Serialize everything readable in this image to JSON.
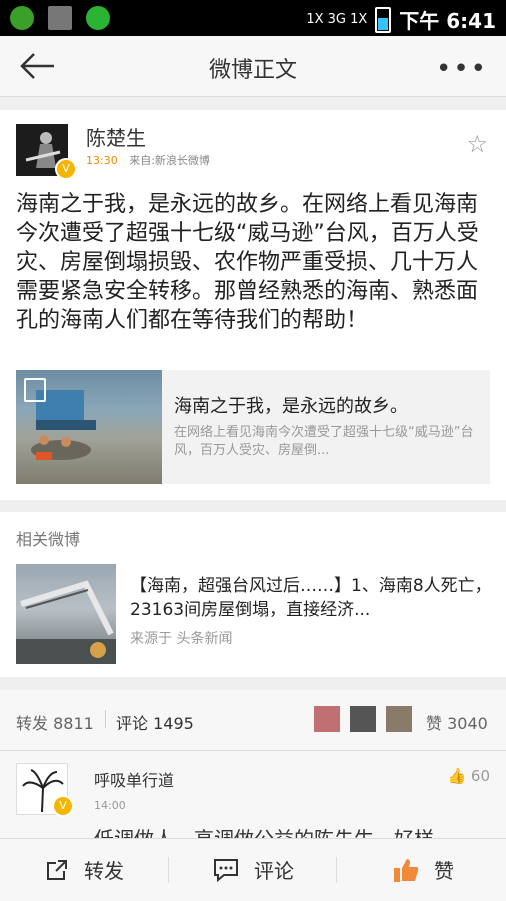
{
  "status_bar": {
    "time": "下午 6:41",
    "network": "1X 3G 1X"
  },
  "header": {
    "title": "微博正文",
    "more": "•••"
  },
  "post": {
    "author": "陈楚生",
    "time": "13:30",
    "source": "来自:新浪长微博",
    "text": "海南之于我，是永远的故乡。在网络上看见海南今次遭受了超强十七级“威马逊”台风，百万人受灾、房屋倒塌损毁、农作物严重受损、几十万人需要紧急安全转移。那曾经熟悉的海南、熟悉面孔的海南人们都在等待我们的帮助！",
    "link": {
      "title": "海南之于我，是永远的故乡。",
      "summary": "在网络上看见海南今次遭受了超强十七级“威马逊”台风，百万人受灾、房屋倒..."
    }
  },
  "related": {
    "heading": "相关微博",
    "item": {
      "title": "【海南，超强台风过后……】1、海南8人死亡，23163间房屋倒塌，直接经济...",
      "source": "来源于 头条新闻"
    }
  },
  "stats": {
    "repost_label": "转发",
    "repost_count": "8811",
    "comment_label": "评论",
    "comment_count": "1495",
    "like_label": "赞",
    "like_count": "3040"
  },
  "comment": {
    "name": "呼吸单行道",
    "time": "14:00",
    "likes": "60",
    "text": "低调做人，高调做公益的陈先生，好样"
  },
  "actions": {
    "repost": "转发",
    "comment": "评论",
    "like": "赞"
  },
  "colors": {
    "accent": "#e88b00",
    "verified": "#f7b500",
    "like": "#f08a3a"
  }
}
